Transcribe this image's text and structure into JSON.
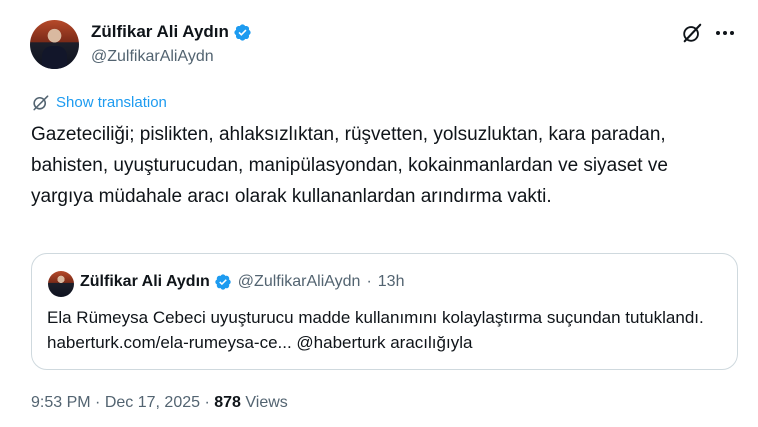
{
  "author": {
    "name": "Zülfikar Ali Aydın",
    "handle": "@ZulfikarAliAydn",
    "verified": true
  },
  "actions": {
    "grok_icon": "grok-icon",
    "more_icon": "more-icon"
  },
  "translate": {
    "label": "Show translation"
  },
  "tweet": {
    "text": "Gazeteciliği; pislikten, ahlaksızlıktan, rüşvetten, yolsuzluktan, kara paradan, bahisten, uyuşturucudan, manipülasyondan, kokainmanlardan ve siyaset ve yargıya müdahale aracı olarak kullananlardan arındırma vakti."
  },
  "quote": {
    "name": "Zülfikar Ali Aydın",
    "handle": "@ZulfikarAliAydn",
    "separator": "·",
    "time": "13h",
    "text": "Ela Rümeysa Cebeci uyuşturucu madde kullanımını kolaylaştırma suçundan tutuklandı. haberturk.com/ela-rumeysa-ce... @haberturk aracılığıyla"
  },
  "footer": {
    "time": "9:53 PM",
    "separator1": "·",
    "date": "Dec 17, 2025",
    "separator2": "·",
    "views_count": "878",
    "views_label": "Views"
  },
  "colors": {
    "accent": "#1d9bf0",
    "text": "#0f1419",
    "muted": "#536471",
    "border": "#cfd9de"
  }
}
